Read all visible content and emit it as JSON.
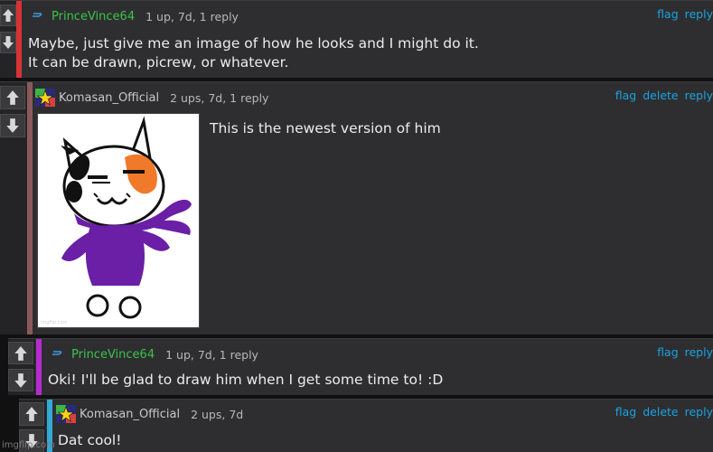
{
  "theme": {
    "bar_red": "#d63434",
    "bar_brown": "#8a5a5a",
    "bar_purple": "#b52bcf",
    "bar_cyan": "#35a9d6",
    "username_green": "#3cc24a",
    "link_blue": "#19a3e0"
  },
  "comments": [
    {
      "username": "PrinceVince64",
      "meta": "1 up, 7d, 1 reply",
      "actions": {
        "flag": "flag",
        "reply": "reply"
      },
      "lines": [
        "Maybe, just give me an image of how he looks and I might do it.",
        "It can be drawn, picrew, or whatever."
      ]
    },
    {
      "username": "Komasan_Official",
      "meta": "2 ups, 7d, 1 reply",
      "actions": {
        "flag": "flag",
        "delete": "delete",
        "reply": "reply"
      },
      "text": "This is the newest version of him",
      "image_watermark": "imgflip.com"
    },
    {
      "username": "PrinceVince64",
      "meta": "1 up, 7d, 1 reply",
      "actions": {
        "flag": "flag",
        "reply": "reply"
      },
      "text": "Oki! I'll be glad to draw him when I get some time to! :D"
    },
    {
      "username": "Komasan_Official",
      "meta": "2 ups, 7d",
      "actions": {
        "flag": "flag",
        "delete": "delete",
        "reply": "reply"
      },
      "text": "Dat cool!"
    }
  ],
  "watermark": "imgflip.com"
}
